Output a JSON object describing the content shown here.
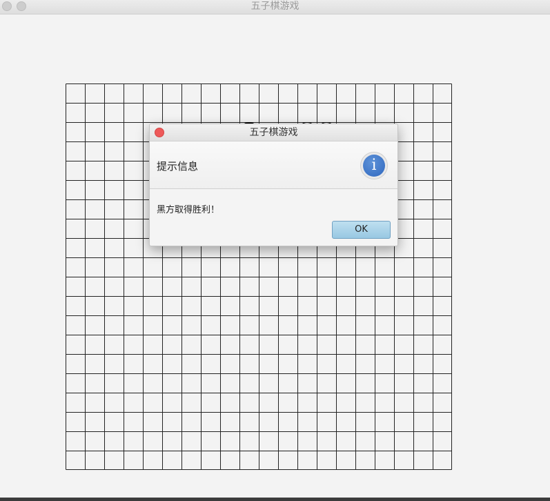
{
  "window": {
    "title": "五子棋游戏"
  },
  "board": {
    "grid_lines": 21,
    "stones": [
      {
        "color": "black",
        "col": 9,
        "row": 2
      },
      {
        "color": "white",
        "col": 12,
        "row": 2
      },
      {
        "color": "white",
        "col": 13,
        "row": 2
      }
    ]
  },
  "dialog": {
    "title": "五子棋游戏",
    "header": "提示信息",
    "icon": "info-icon",
    "message": "黑方取得胜利！",
    "ok_label": "OK"
  },
  "colors": {
    "accent": "#3a76c8",
    "close": "#ee5a5a",
    "ok_button": "#a6d0e8"
  }
}
